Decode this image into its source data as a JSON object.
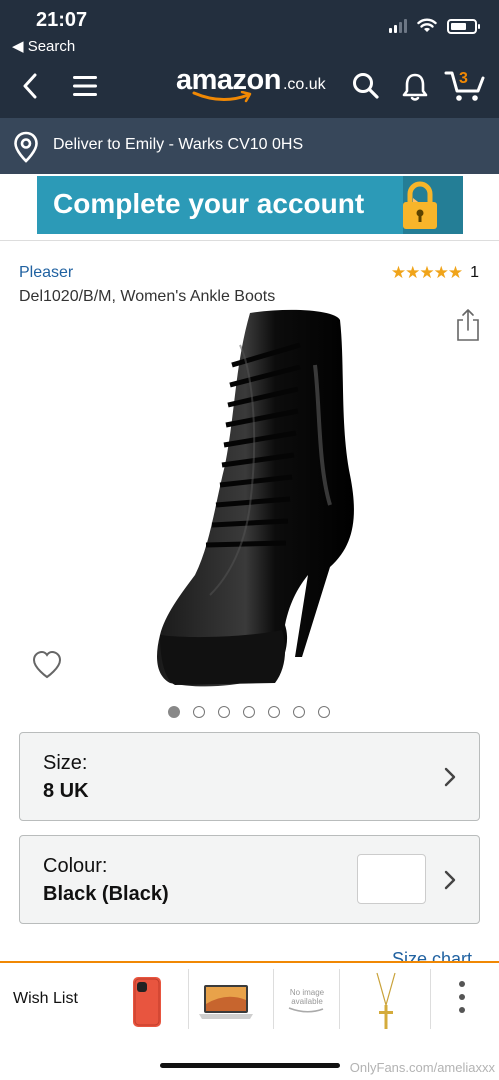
{
  "status_bar": {
    "time": "21:07",
    "back_label": "◀ Search"
  },
  "nav": {
    "logo_text": "amazon",
    "logo_tld": ".co.uk",
    "cart_count": "3",
    "icons": [
      "back-chevron-icon",
      "menu-icon",
      "search-icon",
      "bell-icon",
      "cart-icon"
    ]
  },
  "delivery": {
    "text": "Deliver to Emily - Warks CV10 0HS",
    "icon": "location-pin-icon"
  },
  "banner": {
    "text": "Complete your account",
    "icon": "padlock-icon"
  },
  "product": {
    "brand": "Pleaser",
    "stars": "★★★★★",
    "rating_value": 5,
    "rating_count": "1",
    "title": "Del1020/B/M, Women's Ankle Boots",
    "image_count": 7,
    "active_image": 1
  },
  "options": {
    "size": {
      "label": "Size:",
      "value": "8 UK"
    },
    "colour": {
      "label": "Colour:",
      "value": "Black (Black)"
    }
  },
  "size_chart_label": "Size chart",
  "drawer": {
    "wishlist_label": "Wish List",
    "no_image_line1": "No image",
    "no_image_line2": "available",
    "thumbnails": [
      "phone-thumbnail",
      "laptop-thumbnail",
      "no-image-thumbnail",
      "cross-necklace-thumbnail"
    ]
  },
  "watermark": "OnlyFans.com/ameliaxxx",
  "colors": {
    "header": "#232f3e",
    "delivery": "#37475a",
    "accent": "#f08804",
    "link": "#2162a1",
    "star": "#f0a41a",
    "banner": "#2c9ab7"
  }
}
